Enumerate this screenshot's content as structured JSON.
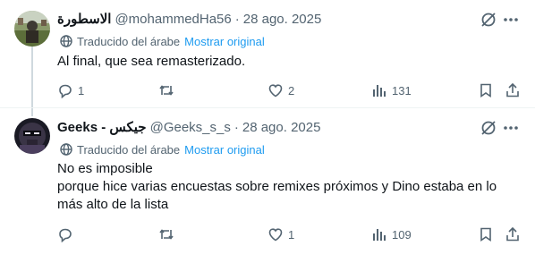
{
  "tweets": [
    {
      "display_name": "الاسطورة",
      "handle": "@mohammedHa56",
      "date": "28 ago. 2025",
      "translated_from": "Traducido del árabe",
      "show_original": "Mostrar original",
      "text_lines": [
        "Al final, que sea remasterizado."
      ],
      "replies": "1",
      "retweets": "",
      "likes": "2",
      "views": "131"
    },
    {
      "display_name": "Geeks - جيكس",
      "handle": "@Geeks_s_s",
      "date": "28 ago. 2025",
      "translated_from": "Traducido del árabe",
      "show_original": "Mostrar original",
      "text_lines": [
        "No es imposible",
        "porque hice varias encuestas sobre remixes próximos y Dino estaba en lo",
        "más alto de la lista"
      ],
      "replies": "",
      "retweets": "",
      "likes": "1",
      "views": "109"
    }
  ],
  "separator": "·",
  "icons": {
    "more": "more-horizontal-icon",
    "grok": "grok-icon",
    "translate": "translate-globe-icon",
    "reply": "reply-icon",
    "retweet": "retweet-icon",
    "like": "heart-icon",
    "views": "views-chart-icon",
    "bookmark": "bookmark-icon",
    "share": "share-icon"
  },
  "colors": {
    "text": "#0f1419",
    "secondary": "#536471",
    "link": "#1d9bf0",
    "line": "#cfd9de"
  }
}
